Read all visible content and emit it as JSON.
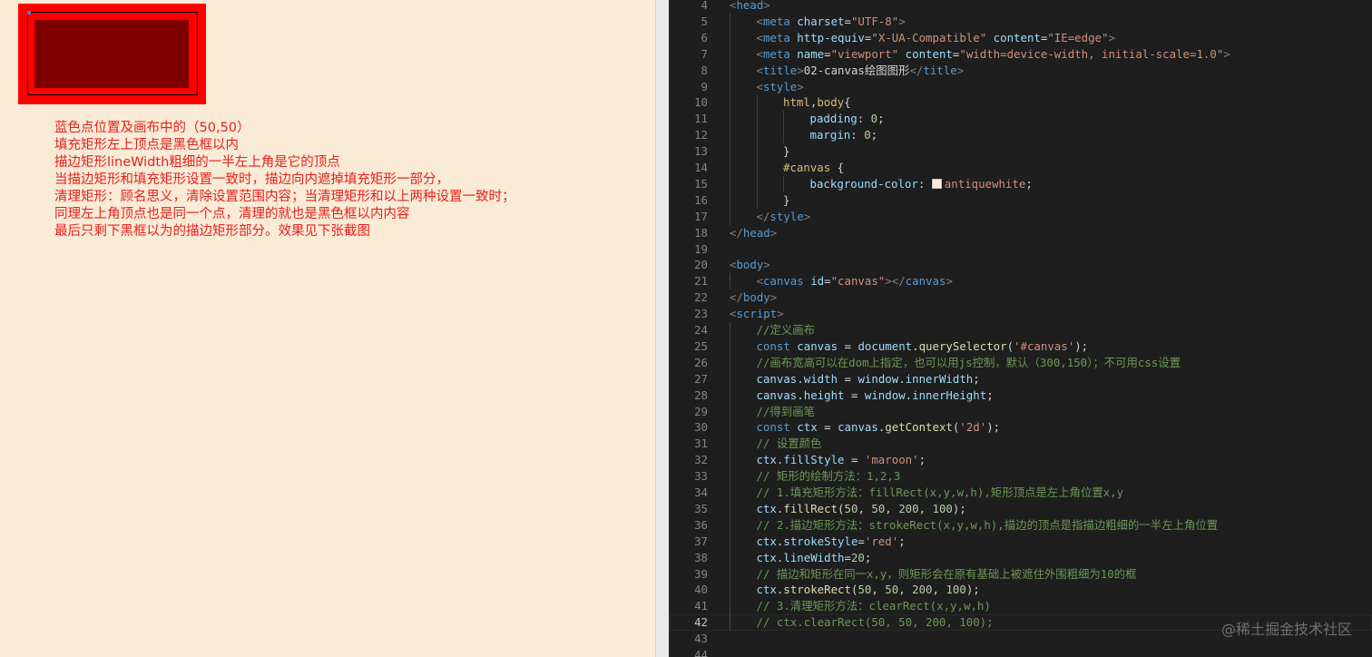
{
  "preview": {
    "notes": [
      "蓝色点位置及画布中的（50,50）",
      "填充矩形左上顶点是黑色框以内",
      "描边矩形lineWidth粗细的一半左上角是它的顶点",
      "当描边矩形和填充矩形设置一致时，描边向内遮掉填充矩形一部分，",
      "清理矩形：顾名思义，清除设置范围内容；当清理矩形和以上两种设置一致时；",
      "同理左上角顶点也是同一个点，清理的就也是黑色框以内内容",
      "最后只剩下黑框以为的描边矩形部分。效果见下张截图"
    ],
    "colors": {
      "canvas_bg": "#faebd7",
      "fill": "#800000",
      "stroke": "#ff0000",
      "frame": "#000000",
      "dot": "#4a7fd8",
      "note_text": "#e8201c"
    }
  },
  "editor": {
    "active_line": 42,
    "lines": [
      {
        "n": 4,
        "indent": 0,
        "tokens": [
          [
            "brk",
            "<"
          ],
          [
            "tag",
            "head"
          ],
          [
            "brk",
            ">"
          ]
        ]
      },
      {
        "n": 5,
        "indent": 1,
        "tokens": [
          [
            "brk",
            "<"
          ],
          [
            "tag",
            "meta"
          ],
          [
            "txt",
            " "
          ],
          [
            "attr",
            "charset"
          ],
          [
            "txt",
            "="
          ],
          [
            "str",
            "\"UTF-8\""
          ],
          [
            "brk",
            ">"
          ]
        ]
      },
      {
        "n": 6,
        "indent": 1,
        "tokens": [
          [
            "brk",
            "<"
          ],
          [
            "tag",
            "meta"
          ],
          [
            "txt",
            " "
          ],
          [
            "attr",
            "http-equiv"
          ],
          [
            "txt",
            "="
          ],
          [
            "str",
            "\"X-UA-Compatible\""
          ],
          [
            "txt",
            " "
          ],
          [
            "attr",
            "content"
          ],
          [
            "txt",
            "="
          ],
          [
            "str",
            "\"IE=edge\""
          ],
          [
            "brk",
            ">"
          ]
        ]
      },
      {
        "n": 7,
        "indent": 1,
        "tokens": [
          [
            "brk",
            "<"
          ],
          [
            "tag",
            "meta"
          ],
          [
            "txt",
            " "
          ],
          [
            "attr",
            "name"
          ],
          [
            "txt",
            "="
          ],
          [
            "str",
            "\"viewport\""
          ],
          [
            "txt",
            " "
          ],
          [
            "attr",
            "content"
          ],
          [
            "txt",
            "="
          ],
          [
            "str",
            "\"width=device-width, initial-scale=1.0\""
          ],
          [
            "brk",
            ">"
          ]
        ]
      },
      {
        "n": 8,
        "indent": 1,
        "tokens": [
          [
            "brk",
            "<"
          ],
          [
            "tag",
            "title"
          ],
          [
            "brk",
            ">"
          ],
          [
            "txt",
            "02-canvas绘图图形"
          ],
          [
            "brk",
            "</"
          ],
          [
            "tag",
            "title"
          ],
          [
            "brk",
            ">"
          ]
        ]
      },
      {
        "n": 9,
        "indent": 1,
        "tokens": [
          [
            "brk",
            "<"
          ],
          [
            "tag",
            "style"
          ],
          [
            "brk",
            ">"
          ]
        ]
      },
      {
        "n": 10,
        "indent": 2,
        "tokens": [
          [
            "sel",
            "html"
          ],
          [
            "txt",
            ","
          ],
          [
            "sel",
            "body"
          ],
          [
            "txt",
            "{"
          ]
        ]
      },
      {
        "n": 11,
        "indent": 3,
        "tokens": [
          [
            "prop",
            "padding"
          ],
          [
            "txt",
            ": "
          ],
          [
            "num",
            "0"
          ],
          [
            "txt",
            ";"
          ]
        ]
      },
      {
        "n": 12,
        "indent": 3,
        "tokens": [
          [
            "prop",
            "margin"
          ],
          [
            "txt",
            ": "
          ],
          [
            "num",
            "0"
          ],
          [
            "txt",
            ";"
          ]
        ]
      },
      {
        "n": 13,
        "indent": 2,
        "tokens": [
          [
            "txt",
            "}"
          ]
        ]
      },
      {
        "n": 14,
        "indent": 2,
        "tokens": [
          [
            "sel",
            "#canvas"
          ],
          [
            "txt",
            " {"
          ]
        ]
      },
      {
        "n": 15,
        "indent": 3,
        "tokens": [
          [
            "prop",
            "background-color"
          ],
          [
            "txt",
            ": "
          ],
          [
            "swatch",
            ""
          ],
          [
            "str",
            "antiquewhite"
          ],
          [
            "txt",
            ";"
          ]
        ]
      },
      {
        "n": 16,
        "indent": 2,
        "tokens": [
          [
            "txt",
            "}"
          ]
        ]
      },
      {
        "n": 17,
        "indent": 1,
        "tokens": [
          [
            "brk",
            "</"
          ],
          [
            "tag",
            "style"
          ],
          [
            "brk",
            ">"
          ]
        ]
      },
      {
        "n": 18,
        "indent": 0,
        "tokens": [
          [
            "brk",
            "</"
          ],
          [
            "tag",
            "head"
          ],
          [
            "brk",
            ">"
          ]
        ]
      },
      {
        "n": 19,
        "indent": 0,
        "tokens": []
      },
      {
        "n": 20,
        "indent": 0,
        "tokens": [
          [
            "brk",
            "<"
          ],
          [
            "tag",
            "body"
          ],
          [
            "brk",
            ">"
          ]
        ]
      },
      {
        "n": 21,
        "indent": 1,
        "tokens": [
          [
            "brk",
            "<"
          ],
          [
            "tag",
            "canvas"
          ],
          [
            "txt",
            " "
          ],
          [
            "attr",
            "id"
          ],
          [
            "txt",
            "="
          ],
          [
            "str",
            "\"canvas\""
          ],
          [
            "brk",
            "></"
          ],
          [
            "tag",
            "canvas"
          ],
          [
            "brk",
            ">"
          ]
        ]
      },
      {
        "n": 22,
        "indent": 0,
        "tokens": [
          [
            "brk",
            "</"
          ],
          [
            "tag",
            "body"
          ],
          [
            "brk",
            ">"
          ]
        ]
      },
      {
        "n": 23,
        "indent": 0,
        "tokens": [
          [
            "brk",
            "<"
          ],
          [
            "tag",
            "script"
          ],
          [
            "brk",
            ">"
          ]
        ]
      },
      {
        "n": 24,
        "indent": 1,
        "tokens": [
          [
            "cmt",
            "//定义画布"
          ]
        ]
      },
      {
        "n": 25,
        "indent": 1,
        "tokens": [
          [
            "kw",
            "const"
          ],
          [
            "txt",
            " "
          ],
          [
            "var",
            "canvas"
          ],
          [
            "txt",
            " = "
          ],
          [
            "var",
            "document"
          ],
          [
            "txt",
            "."
          ],
          [
            "fn",
            "querySelector"
          ],
          [
            "txt",
            "("
          ],
          [
            "str",
            "'#canvas'"
          ],
          [
            "txt",
            ");"
          ]
        ]
      },
      {
        "n": 26,
        "indent": 1,
        "tokens": [
          [
            "cmt",
            "//画布宽高可以在dom上指定，也可以用js控制，默认（300,150）；不可用css设置"
          ]
        ]
      },
      {
        "n": 27,
        "indent": 1,
        "tokens": [
          [
            "var",
            "canvas"
          ],
          [
            "txt",
            "."
          ],
          [
            "var",
            "width"
          ],
          [
            "txt",
            " = "
          ],
          [
            "var",
            "window"
          ],
          [
            "txt",
            "."
          ],
          [
            "var",
            "innerWidth"
          ],
          [
            "txt",
            ";"
          ]
        ]
      },
      {
        "n": 28,
        "indent": 1,
        "tokens": [
          [
            "var",
            "canvas"
          ],
          [
            "txt",
            "."
          ],
          [
            "var",
            "height"
          ],
          [
            "txt",
            " = "
          ],
          [
            "var",
            "window"
          ],
          [
            "txt",
            "."
          ],
          [
            "var",
            "innerHeight"
          ],
          [
            "txt",
            ";"
          ]
        ]
      },
      {
        "n": 29,
        "indent": 1,
        "tokens": [
          [
            "cmt",
            "//得到画笔"
          ]
        ]
      },
      {
        "n": 30,
        "indent": 1,
        "tokens": [
          [
            "kw",
            "const"
          ],
          [
            "txt",
            " "
          ],
          [
            "var",
            "ctx"
          ],
          [
            "txt",
            " = "
          ],
          [
            "var",
            "canvas"
          ],
          [
            "txt",
            "."
          ],
          [
            "fn",
            "getContext"
          ],
          [
            "txt",
            "("
          ],
          [
            "str",
            "'2d'"
          ],
          [
            "txt",
            ");"
          ]
        ]
      },
      {
        "n": 31,
        "indent": 1,
        "tokens": [
          [
            "cmt",
            "// 设置颜色"
          ]
        ]
      },
      {
        "n": 32,
        "indent": 1,
        "tokens": [
          [
            "var",
            "ctx"
          ],
          [
            "txt",
            "."
          ],
          [
            "var",
            "fillStyle"
          ],
          [
            "txt",
            " = "
          ],
          [
            "str",
            "'maroon'"
          ],
          [
            "txt",
            ";"
          ]
        ]
      },
      {
        "n": 33,
        "indent": 1,
        "tokens": [
          [
            "cmt",
            "// 矩形的绘制方法：1,2,3"
          ]
        ]
      },
      {
        "n": 34,
        "indent": 1,
        "tokens": [
          [
            "cmt",
            "// 1.填充矩形方法：fillRect(x,y,w,h),矩形顶点是左上角位置x,y"
          ]
        ]
      },
      {
        "n": 35,
        "indent": 1,
        "tokens": [
          [
            "var",
            "ctx"
          ],
          [
            "txt",
            "."
          ],
          [
            "fn",
            "fillRect"
          ],
          [
            "txt",
            "("
          ],
          [
            "num",
            "50"
          ],
          [
            "txt",
            ", "
          ],
          [
            "num",
            "50"
          ],
          [
            "txt",
            ", "
          ],
          [
            "num",
            "200"
          ],
          [
            "txt",
            ", "
          ],
          [
            "num",
            "100"
          ],
          [
            "txt",
            ");"
          ]
        ]
      },
      {
        "n": 36,
        "indent": 1,
        "tokens": [
          [
            "cmt",
            "// 2.描边矩形方法：strokeRect(x,y,w,h),描边的顶点是指描边粗细的一半左上角位置"
          ]
        ]
      },
      {
        "n": 37,
        "indent": 1,
        "tokens": [
          [
            "var",
            "ctx"
          ],
          [
            "txt",
            "."
          ],
          [
            "var",
            "strokeStyle"
          ],
          [
            "txt",
            "="
          ],
          [
            "str",
            "'red'"
          ],
          [
            "txt",
            ";"
          ]
        ]
      },
      {
        "n": 38,
        "indent": 1,
        "tokens": [
          [
            "var",
            "ctx"
          ],
          [
            "txt",
            "."
          ],
          [
            "var",
            "lineWidth"
          ],
          [
            "txt",
            "="
          ],
          [
            "num",
            "20"
          ],
          [
            "txt",
            ";"
          ]
        ]
      },
      {
        "n": 39,
        "indent": 1,
        "tokens": [
          [
            "cmt",
            "// 描边和矩形在同一x,y，则矩形会在原有基础上被遮住外围粗细为10的框"
          ]
        ]
      },
      {
        "n": 40,
        "indent": 1,
        "tokens": [
          [
            "var",
            "ctx"
          ],
          [
            "txt",
            "."
          ],
          [
            "fn",
            "strokeRect"
          ],
          [
            "txt",
            "("
          ],
          [
            "num",
            "50"
          ],
          [
            "txt",
            ", "
          ],
          [
            "num",
            "50"
          ],
          [
            "txt",
            ", "
          ],
          [
            "num",
            "200"
          ],
          [
            "txt",
            ", "
          ],
          [
            "num",
            "100"
          ],
          [
            "txt",
            ");"
          ]
        ]
      },
      {
        "n": 41,
        "indent": 1,
        "tokens": [
          [
            "cmt",
            "// 3.清理矩形方法：clearRect(x,y,w,h)"
          ]
        ]
      },
      {
        "n": 42,
        "indent": 1,
        "tokens": [
          [
            "cmt",
            "// ctx.clearRect(50, 50, 200, 100);"
          ]
        ]
      },
      {
        "n": 43,
        "indent": 0,
        "tokens": []
      },
      {
        "n": 44,
        "indent": 0,
        "tokens": []
      }
    ]
  },
  "watermark": "@稀土掘金技术社区"
}
